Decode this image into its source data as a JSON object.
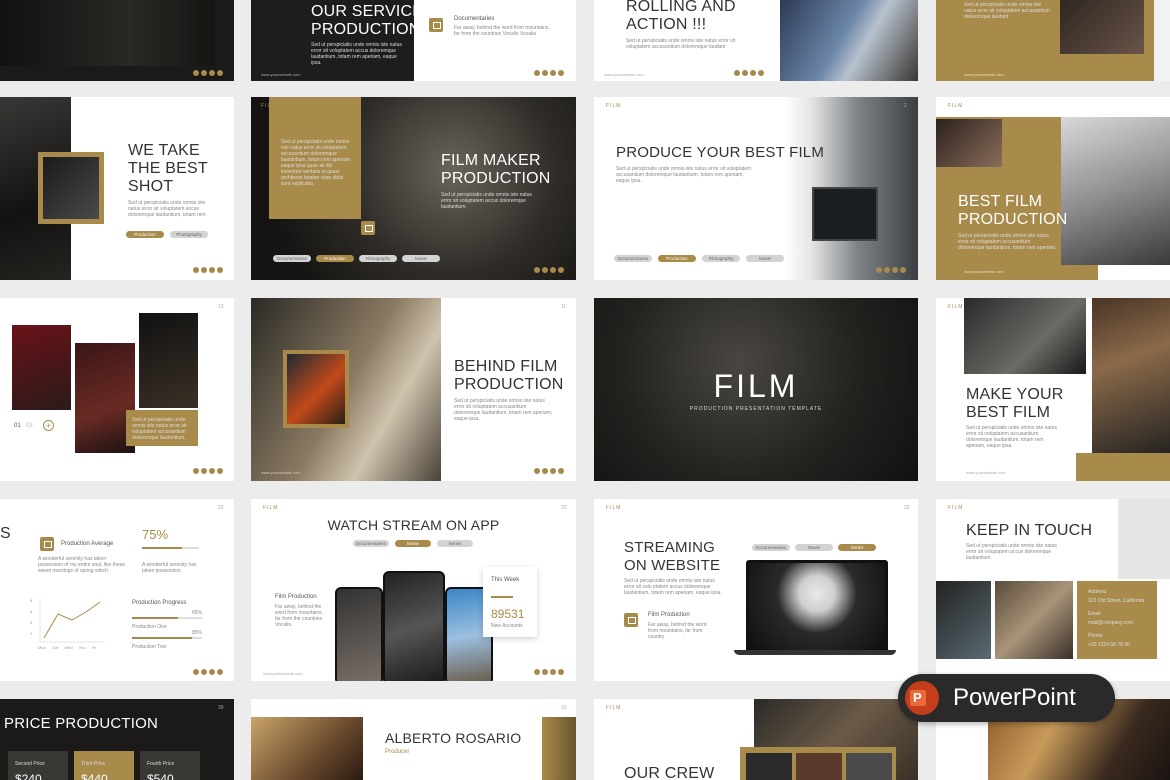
{
  "slides": {
    "s02": {
      "title_line1": "OUR SERVICE",
      "title_line2": "PRODUCTION",
      "body": "Sed ut perspiciatis unde omnis iste natus error sit voluptatem accus doloremque laudantium, totam rem aperiam, eaque ipsa.",
      "item": "Documentaries",
      "item_body": "Far away, behind the word from mountains, far from the countries Vocalis Vocalia"
    },
    "s03": {
      "title_line1": "ROLLING AND",
      "title_line2": "ACTION !!!",
      "body": "Sed ut perspiciatis unde omnis iste natus error sit voluptatem accusantium doloremque laudant"
    },
    "s04": {
      "body": "Sed ut perspiciatis unde omnis iste natus error sit voluptatem accusantium doloremque laudant"
    },
    "s05": {
      "title_line1": "WE TAKE",
      "title_line2": "THE BEST",
      "title_line3": "SHOT",
      "body": "Sed ut perspiciatis unde omnis iste natus error sit voluptatem accus doloremque laudantium, totam rem.",
      "tag1": "Production",
      "tag2": "Photography"
    },
    "s06": {
      "label": "FILM",
      "title_line1": "FILM MAKER",
      "title_line2": "PRODUCTION",
      "box_body": "Sed ut perspiciatis unde omnis iste natus error sit voluptatem accusantium doloremque laudantium, totam rem aperiam, eaque ipsa quae ab illo inventore veritatis et quasi architecto beatae vitae dicta sunt explicabo.",
      "body": "Sed ut perspiciatis unde omnis iste natus error sit voluptatem accus doloremque laudantium.",
      "tag1": "Documentaries",
      "tag2": "Production",
      "tag3": "Filmography",
      "tag4": "Movie"
    },
    "s07": {
      "label": "FILM",
      "title": "PRODUCE YOUR BEST FILM",
      "body": "Sed ut perspiciatis unde omnis iste natus error sit voluptatem accusantium doloremque laudantium, totam rem aperiam, eaque ipsa.",
      "tag1": "Documentaries",
      "tag2": "Production",
      "tag3": "Filmography",
      "tag4": "Movie",
      "page": "2"
    },
    "s08": {
      "label": "FILM",
      "title_line1": "BEST FILM",
      "title_line2": "PRODUCTION",
      "body": "Sed ut perspiciatis unde omnis iste natus error sit voluptatem accusantium doloremque laudantium, totam rem aperiam."
    },
    "s09": {
      "box_body": "Sed ut perspiciatis unde omnis iste natus error sit voluptatem accusantium doloremque laudantium.",
      "n1": "01",
      "n2": "03",
      "page": "13"
    },
    "s10": {
      "title_line1": "BEHIND FILM",
      "title_line2": "PRODUCTION",
      "body": "Sed ut perspiciatis unde omnis iste natus error sit voluptatem accusantium doloremque laudantium, totam rem aperiam, eaque ipsa.",
      "page": "11"
    },
    "s11": {
      "title": "FILM",
      "subtitle": "PRODUCTION PRESENTATION TEMPLATE"
    },
    "s12": {
      "label": "FILM",
      "title_line1": "MAKE YOUR",
      "title_line2": "BEST FILM",
      "body": "Sed ut perspiciatis unde omnis iste natus error sit voluptatem accusantium doloremque laudantium, totam rem aperiam, eaque ipsa."
    },
    "s13": {
      "title_tail": "S",
      "item": "Production Average",
      "item_body": "A wonderful serenity has taken possession of my entire soul, like these sweet mornings of spring which",
      "pct": "75%",
      "pct_body": "A wonderful serenity has taken possession",
      "progress_title": "Production Progress",
      "p1": "Production One",
      "p1_val": "65%",
      "p2": "Production Two",
      "p2_val": "85%",
      "y_ticks": [
        "8",
        "6",
        "4",
        "2",
        "0"
      ],
      "x_ticks": [
        "Mon",
        "Tue",
        "Wed",
        "Thu",
        "Fri"
      ],
      "page": "23"
    },
    "s14": {
      "label": "FILM",
      "title": "WATCH STREAM ON APP",
      "tag1": "Documentaries",
      "tag2": "Movie",
      "tag3": "Series",
      "item": "Film Production",
      "item_body": "Far away, behind the word from mountains, far from the countries Vocalis.",
      "card_title": "This Week",
      "card_value": "89531",
      "card_sub": "New Accounts",
      "page": "22"
    },
    "s15": {
      "label": "FILM",
      "title_line1": "STREAMING",
      "title_line2": "ON WEBSITE",
      "body": "Sed ut perspiciatis unde omnis iste natus error sit volu ptatem accus doloremque laudantium, totam rem aperiam, eaque ipsa.",
      "item": "Film Production",
      "item_body": "Far away, behind the word from mountains, far from country",
      "tag1": "Documentaries",
      "tag2": "Movie",
      "tag3": "Series",
      "page": "22"
    },
    "s16": {
      "label": "FILM",
      "title": "KEEP IN TOUCH",
      "body": "Sed ut perspiciatis unde omnis iste natus error sit voluptatem accus doloremque laudantium.",
      "addr_label": "Address",
      "addr": "123 Old Street, California",
      "email_label": "Email",
      "email": "mail@company.com",
      "phone_label": "Phone",
      "phone": "+00 1234 56 78 90"
    },
    "s17": {
      "title": "PRICE PRODUCTION",
      "p2": "Second Price",
      "p3": "Third Price",
      "p4": "Fourth Price",
      "v2": "$240",
      "v3": "$440",
      "v4": "$540",
      "page": "39"
    },
    "s18": {
      "name": "ALBERTO ROSARIO",
      "role": "Producer",
      "page": "31"
    },
    "s19": {
      "label": "FILM",
      "title": "OUR CREW"
    },
    "footer": {
      "website": "www.yourwebsite.com"
    },
    "badge": {
      "label": "PowerPoint",
      "icon_letter": "P"
    }
  },
  "colors": {
    "gold": "#a88a4a",
    "dark": "#1b1a18",
    "badge": "#2a2a2a",
    "pp_red": "#c43e1c"
  }
}
